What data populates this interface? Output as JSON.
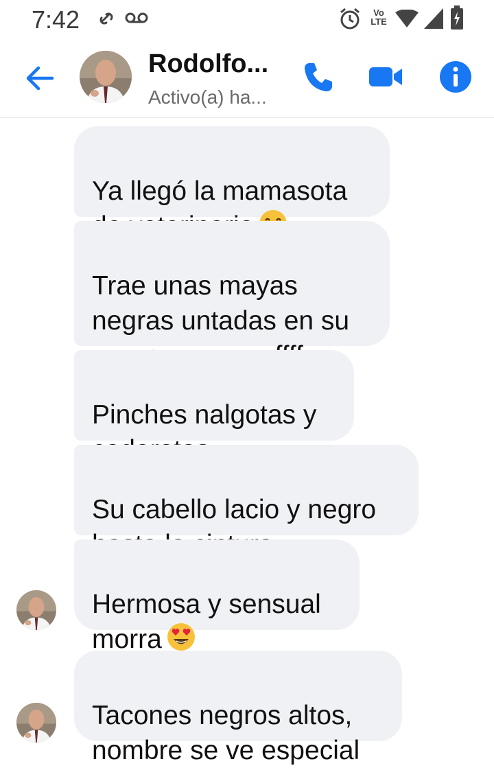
{
  "status_bar": {
    "time": "7:42",
    "network_label_top": "Vo",
    "network_label_bottom": "LTE"
  },
  "header": {
    "contact_name": "Rodolfo...",
    "contact_status": "Activo(a) ha..."
  },
  "messages": [
    {
      "text": "Ya llegó la mamasota\nde veterinaria",
      "emoji": "drooling-face-emoji"
    },
    {
      "text": "Trae unas mayas\nnegras untadas en su\ncuerpo, se ve uffff"
    },
    {
      "text": "Pinches nalgotas y\ncaderotas"
    },
    {
      "text": "Su cabello lacio y negro\nhasta la cintura"
    },
    {
      "text": "Hermosa y sensual\nmorra",
      "emoji": "heart-eyes-emoji"
    },
    {
      "text": "Tacones negros altos,\nnombre se ve especial"
    }
  ],
  "colors": {
    "accent": "#1877f2",
    "bubble": "#f0f1f5"
  }
}
